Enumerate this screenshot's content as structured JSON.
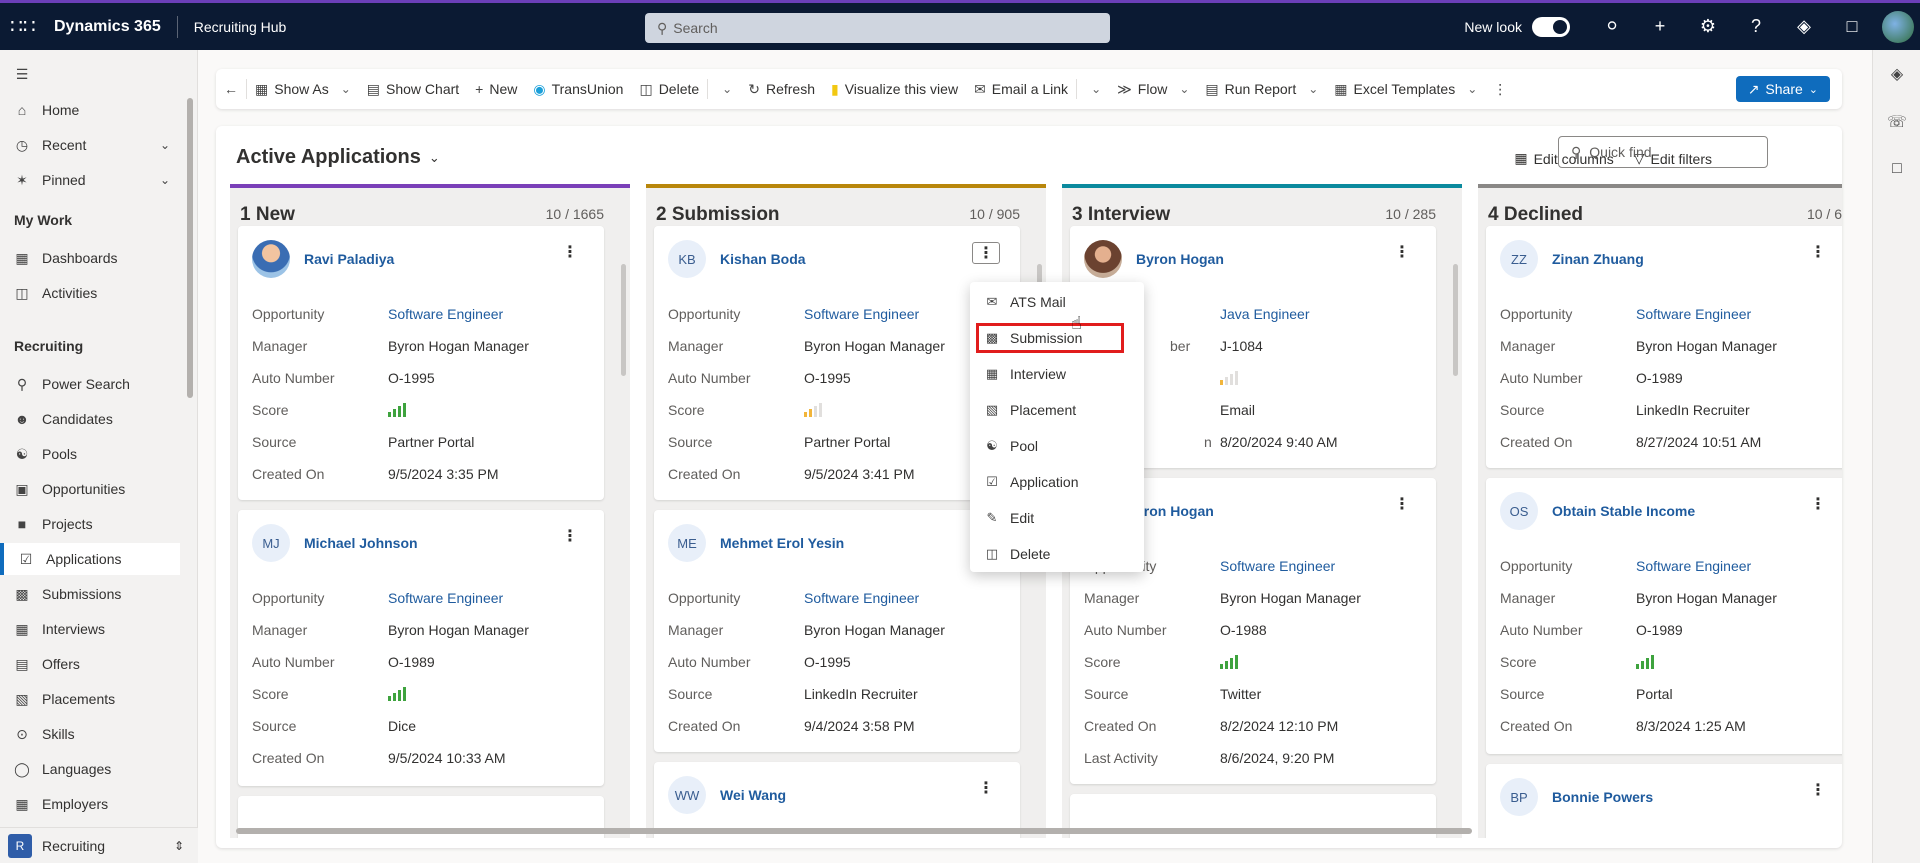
{
  "topbar": {
    "app": "Dynamics 365",
    "hub": "Recruiting Hub",
    "search_placeholder": "Search",
    "new_look": "New look"
  },
  "sidebar": {
    "home": "Home",
    "recent": "Recent",
    "pinned": "Pinned",
    "my_work": "My Work",
    "dashboards": "Dashboards",
    "activities": "Activities",
    "recruiting": "Recruiting",
    "items": [
      "Power Search",
      "Candidates",
      "Pools",
      "Opportunities",
      "Projects",
      "Applications",
      "Submissions",
      "Interviews",
      "Offers",
      "Placements",
      "Skills",
      "Languages",
      "Employers"
    ],
    "area_letter": "R",
    "area": "Recruiting"
  },
  "cmdbar": {
    "show_as": "Show As",
    "show_chart": "Show Chart",
    "new": "New",
    "transunion": "TransUnion",
    "delete": "Delete",
    "refresh": "Refresh",
    "visualize": "Visualize this view",
    "email_link": "Email a Link",
    "flow": "Flow",
    "run_report": "Run Report",
    "excel": "Excel Templates",
    "share": "Share"
  },
  "view": {
    "title": "Active Applications",
    "edit_columns": "Edit columns",
    "edit_filters": "Edit filters",
    "quick_find": "Quick find"
  },
  "labels": {
    "opportunity": "Opportunity",
    "manager": "Manager",
    "auto": "Auto Number",
    "score": "Score",
    "source": "Source",
    "created": "Created On",
    "last_activity": "Last Activity",
    "number_partial": "ber",
    "on_partial": "n"
  },
  "lanes": [
    {
      "title": "1 New",
      "count": "10 / 1665",
      "color": "#7a3fb8",
      "cards": [
        {
          "initials": "",
          "name": "Ravi Paladiya",
          "opp": "Software Engineer",
          "mgr": "Byron Hogan Manager",
          "auto": "O-1995",
          "score": 4,
          "source": "Partner Portal",
          "created": "9/5/2024 3:35 PM"
        },
        {
          "initials": "MJ",
          "name": "Michael Johnson",
          "opp": "Software Engineer",
          "mgr": "Byron Hogan Manager",
          "auto": "O-1989",
          "score": 4,
          "source": "Dice",
          "created": "9/5/2024 10:33 AM"
        }
      ]
    },
    {
      "title": "2 Submission",
      "count": "10 / 905",
      "color": "#b8860b",
      "cards": [
        {
          "initials": "KB",
          "name": "Kishan Boda",
          "opp": "Software Engineer",
          "mgr": "Byron Hogan Manager",
          "auto": "O-1995",
          "score": 2,
          "source": "Partner Portal",
          "created": "9/5/2024 3:41 PM"
        },
        {
          "initials": "ME",
          "name": "Mehmet Erol Yesin",
          "opp": "Software Engineer",
          "mgr": "Byron Hogan Manager",
          "auto": "O-1995",
          "source": "LinkedIn Recruiter",
          "created": "9/4/2024 3:58 PM"
        },
        {
          "initials": "WW",
          "name": "Wei Wang"
        }
      ]
    },
    {
      "title": "3 Interview",
      "count": "10 / 285",
      "color": "#0b8a9e",
      "cards": [
        {
          "name": "Byron Hogan",
          "opp": "Java Engineer",
          "num": "J-1084",
          "score": 1,
          "source": "Email",
          "created": "8/20/2024 9:40 AM"
        },
        {
          "name": "yron Hogan",
          "opp": "Software Engineer",
          "mgr": "Byron Hogan Manager",
          "auto": "O-1988",
          "score": 4,
          "source": "Twitter",
          "created": "8/2/2024 12:10 PM",
          "last": "8/6/2024, 9:20 PM"
        }
      ]
    },
    {
      "title": "4 Declined",
      "count": "10 / 6",
      "color": "#8a8886",
      "cards": [
        {
          "initials": "ZZ",
          "name": "Zinan Zhuang",
          "opp": "Software Engineer",
          "mgr": "Byron Hogan Manager",
          "auto": "O-1989",
          "source": "LinkedIn Recruiter",
          "created": "8/27/2024 10:51 AM"
        },
        {
          "initials": "OS",
          "name": "Obtain Stable Income",
          "opp": "Software Engineer",
          "mgr": "Byron Hogan Manager",
          "auto": "O-1989",
          "score": 4,
          "source": "Portal",
          "created": "8/3/2024 1:25 AM"
        },
        {
          "initials": "BP",
          "name": "Bonnie Powers"
        }
      ]
    }
  ],
  "menu": {
    "items": [
      "ATS Mail",
      "Submission",
      "Interview",
      "Placement",
      "Pool",
      "Application",
      "Edit",
      "Delete"
    ],
    "highlighted": "Submission"
  },
  "colors": {
    "topbar": "#0b1a33",
    "link": "#1f5b9e",
    "accent": "#0f6cbd",
    "highlight": "#e11c1c",
    "score": "#3ea33e",
    "score_low": "#f2b53a"
  }
}
